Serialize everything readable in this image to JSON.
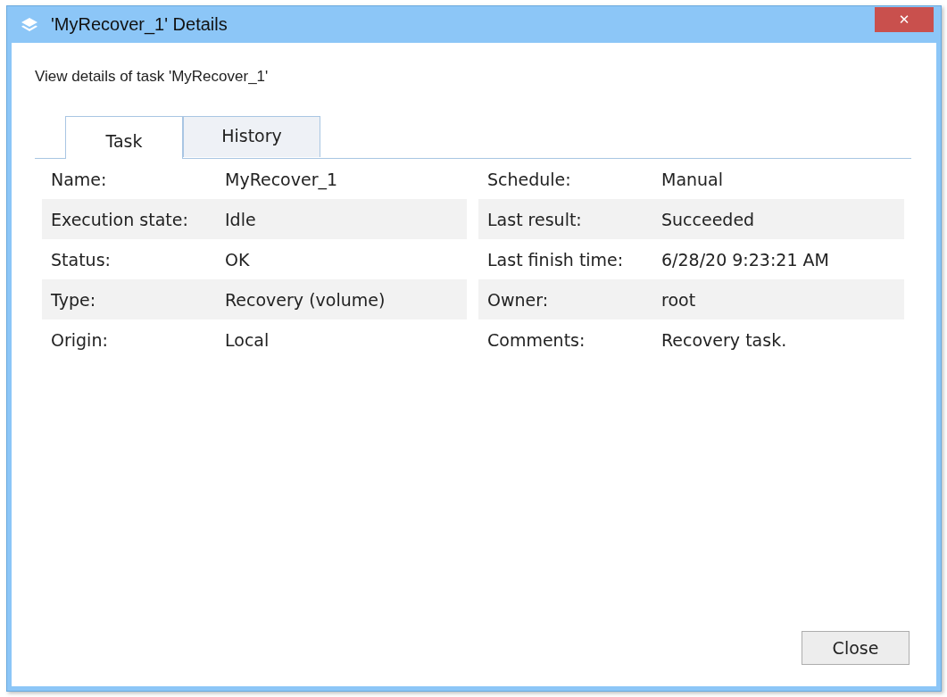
{
  "window": {
    "title": "'MyRecover_1' Details",
    "close": "✕"
  },
  "subtitle": "View details of task 'MyRecover_1'",
  "tabs": [
    {
      "label": "Task",
      "selected": true
    },
    {
      "label": "History",
      "selected": false
    }
  ],
  "fields": [
    [
      {
        "label": "Name:",
        "value": "MyRecover_1"
      },
      {
        "label": "Schedule:",
        "value": "Manual"
      }
    ],
    [
      {
        "label": "Execution state:",
        "value": "Idle"
      },
      {
        "label": "Last result:",
        "value": "Succeeded"
      }
    ],
    [
      {
        "label": "Status:",
        "value": "OK"
      },
      {
        "label": "Last finish time:",
        "value": "6/28/20 9:23:21 AM"
      }
    ],
    [
      {
        "label": "Type:",
        "value": "Recovery (volume)"
      },
      {
        "label": "Owner:",
        "value": "root"
      }
    ],
    [
      {
        "label": "Origin:",
        "value": "Local"
      },
      {
        "label": "Comments:",
        "value": "Recovery task."
      }
    ]
  ],
  "buttons": [
    "Close"
  ]
}
